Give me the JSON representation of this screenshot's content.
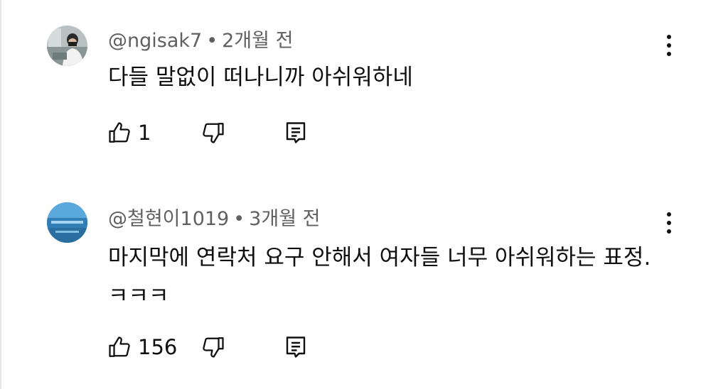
{
  "comments": [
    {
      "handle": "@ngisak7",
      "separator": "•",
      "time": "2개월 전",
      "text": "다들 말없이 떠나니까 아쉬워하네",
      "likes": "1",
      "avatar_icon": "user-photo-avatar"
    },
    {
      "handle": "@철현이1019",
      "separator": "•",
      "time": "3개월 전",
      "text": "마지막에 연락처 요구 안해서 여자들 너무 아쉬워하는 표정. ㅋㅋㅋ",
      "likes": "156",
      "avatar_icon": "landscape-photo-avatar"
    }
  ],
  "icons": {
    "like": "thumbs-up-icon",
    "dislike": "thumbs-down-icon",
    "reply": "reply-icon",
    "more": "more-vertical-icon"
  }
}
